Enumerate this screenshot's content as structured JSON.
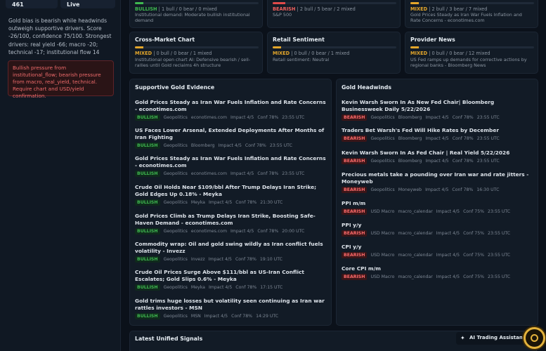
{
  "sidebar": {
    "stat_a": "461",
    "stat_b": "Live",
    "summary": "Gold bias is bearish while headwinds outweigh supportive drivers. Score -26/100, confidence 75/100. Strongest drivers: real yield -66; macro -20; technical -17; institutional flow 14",
    "alert": "Bullish pressure from institutional_flow; bearish pressure from macro, real_yield, technical. Require chart and USD/yield confirmation."
  },
  "top_cards": [
    {
      "label": "BULLISH",
      "counts": "| 1 bull / 0 bear / 0 mixed",
      "note": "Institutional demand: Moderate bullish institutional demand"
    },
    {
      "label": "BEARISH",
      "counts": "| 2 bull / 5 bear / 2 mixed",
      "note": "S&P 500"
    },
    {
      "label": "MIXED",
      "counts": "| 2 bull / 3 bear / 7 mixed",
      "note": "Gold Prices Steady as Iran War Fuels Inflation and Rate Concerns - econotimes.com"
    }
  ],
  "cards": [
    {
      "title": "Cross-Market Chart",
      "label": "MIXED",
      "counts": "| 0 bull / 0 bear / 1 mixed",
      "note": "Institutional open chart AI: Defensive bearish / sell-rallies until Gold reclaims 4h structure"
    },
    {
      "title": "Retail Sentiment",
      "label": "MIXED",
      "counts": "| 0 bull / 0 bear / 1 mixed",
      "note": "Retail sentiment: Neutral"
    },
    {
      "title": "Provider News",
      "label": "MIXED",
      "counts": "| 0 bull / 0 bear / 12 mixed",
      "note": "US Fed ramps up demands for corrective actions by regional banks - Bloomberg News"
    }
  ],
  "supportive": {
    "title": "Supportive Gold Evidence",
    "badge": "BULLISH",
    "items": [
      {
        "title": "Gold Prices Steady as Iran War Fuels Inflation and Rate Concerns - econotimes.com",
        "meta": [
          "Geopolitics",
          "econotimes.com",
          "Impact 4/5",
          "Conf 78%",
          "23:55 UTC"
        ]
      },
      {
        "title": "US Faces Lower Arsenal, Extended Deployments After Months of Iran Fighting",
        "meta": [
          "Geopolitics",
          "Bloomberg",
          "Impact 4/5",
          "Conf 78%",
          "23:55 UTC"
        ]
      },
      {
        "title": "Gold Prices Steady as Iran War Fuels Inflation and Rate Concerns - econotimes.com",
        "meta": [
          "Geopolitics",
          "econotimes.com",
          "Impact 4/5",
          "Conf 78%",
          "23:55 UTC"
        ]
      },
      {
        "title": "Crude Oil Holds Near $109/bbl After Trump Delays Iran Strike; Gold Edges Up 0.18% - Meyka",
        "meta": [
          "Geopolitics",
          "Meyka",
          "Impact 4/5",
          "Conf 78%",
          "21:30 UTC"
        ]
      },
      {
        "title": "Gold Prices Climb as Trump Delays Iran Strike, Boosting Safe-Haven Demand - econotimes.com",
        "meta": [
          "Geopolitics",
          "econotimes.com",
          "Impact 4/5",
          "Conf 78%",
          "20:00 UTC"
        ]
      },
      {
        "title": "Commodity wrap: Oil and gold swing wildly as Iran conflict fuels volatility - Invezz",
        "meta": [
          "Geopolitics",
          "Invezz",
          "Impact 4/5",
          "Conf 78%",
          "19:10 UTC"
        ]
      },
      {
        "title": "Crude Oil Prices Surge Above $111/bbl as US-Iran Conflict Escalates; Gold Slips 0.6% - Meyka",
        "meta": [
          "Geopolitics",
          "Meyka",
          "Impact 4/5",
          "Conf 78%",
          "17:15 UTC"
        ]
      },
      {
        "title": "Gold trims huge losses but volatility seen continuing as Iran war rattles investors - MSN",
        "meta": [
          "Geopolitics",
          "MSN",
          "Impact 4/5",
          "Conf 78%",
          "14:29 UTC"
        ]
      }
    ]
  },
  "headwinds": {
    "title": "Gold Headwinds",
    "badge": "BEARISH",
    "items": [
      {
        "title": "Kevin Warsh Sworn In As New Fed Chair| Bloomberg Businessweek Daily 5/22/2026",
        "meta": [
          "Geopolitics",
          "Bloomberg",
          "Impact 4/5",
          "Conf 78%",
          "23:55 UTC"
        ]
      },
      {
        "title": "Traders Bet Warsh's Fed Will Hike Rates by December",
        "meta": [
          "Geopolitics",
          "Bloomberg",
          "Impact 4/5",
          "Conf 78%",
          "23:55 UTC"
        ]
      },
      {
        "title": "Kevin Warsh Sworn In As Fed Chair | Real Yield 5/22/2026",
        "meta": [
          "Geopolitics",
          "Bloomberg",
          "Impact 4/5",
          "Conf 78%",
          "23:55 UTC"
        ]
      },
      {
        "title": "Precious metals take a pounding over Iran war and rate jitters - Moneyweb",
        "meta": [
          "Geopolitics",
          "Moneyweb",
          "Impact 4/5",
          "Conf 78%",
          "16:30 UTC"
        ]
      },
      {
        "title": "PPI m/m",
        "meta": [
          "USD Macro",
          "macro_calendar",
          "Impact 4/5",
          "Conf 75%",
          "23:55 UTC"
        ]
      },
      {
        "title": "PPI y/y",
        "meta": [
          "USD Macro",
          "macro_calendar",
          "Impact 4/5",
          "Conf 75%",
          "23:55 UTC"
        ]
      },
      {
        "title": "CPI y/y",
        "meta": [
          "USD Macro",
          "macro_calendar",
          "Impact 4/5",
          "Conf 75%",
          "23:55 UTC"
        ]
      },
      {
        "title": "Core CPI m/m",
        "meta": [
          "USD Macro",
          "macro_calendar",
          "Impact 4/5",
          "Conf 75%",
          "23:55 UTC"
        ]
      }
    ]
  },
  "latest": {
    "title": "Latest Unified Signals"
  },
  "assistant": {
    "label": "AI Trading Assistant",
    "icon": "sparkle-icon"
  }
}
